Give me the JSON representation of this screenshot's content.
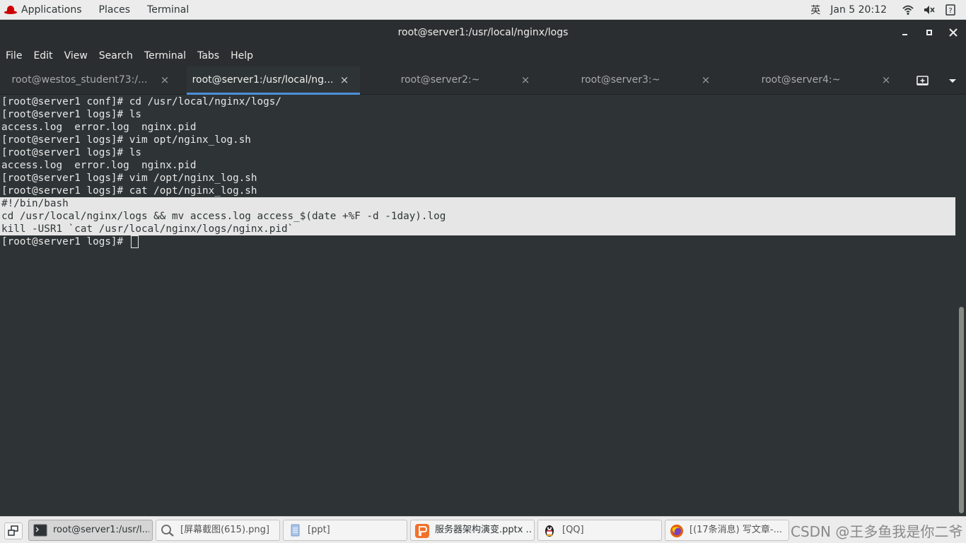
{
  "top_panel": {
    "menu": [
      "Applications",
      "Places",
      "Terminal"
    ],
    "input_method": "英",
    "clock": "Jan 5  20:12",
    "icons": [
      "wifi-icon",
      "volume-icon",
      "help-icon"
    ]
  },
  "window": {
    "title": "root@server1:/usr/local/nginx/logs",
    "controls": [
      "minimize-icon",
      "maximize-icon",
      "close-icon"
    ]
  },
  "menubar": [
    "File",
    "Edit",
    "View",
    "Search",
    "Terminal",
    "Tabs",
    "Help"
  ],
  "tabs": [
    {
      "label": "root@westos_student73:/...",
      "active": false
    },
    {
      "label": "root@server1:/usr/local/ng...",
      "active": true
    },
    {
      "label": "root@server2:~",
      "active": false
    },
    {
      "label": "root@server3:~",
      "active": false
    },
    {
      "label": "root@server4:~",
      "active": false
    }
  ],
  "tab_close": "×",
  "terminal": {
    "lines": [
      "[root@server1 conf]# cd /usr/local/nginx/logs/",
      "[root@server1 logs]# ls",
      "access.log  error.log  nginx.pid",
      "[root@server1 logs]# vim opt/nginx_log.sh",
      "[root@server1 logs]# ls",
      "access.log  error.log  nginx.pid",
      "[root@server1 logs]# vim /opt/nginx_log.sh",
      "[root@server1 logs]# cat /opt/nginx_log.sh"
    ],
    "selected_lines": [
      "#!/bin/bash",
      "cd /usr/local/nginx/logs && mv access.log access_$(date +%F -d -1day).log",
      "kill -USR1 `cat /usr/local/nginx/logs/nginx.pid`"
    ],
    "prompt": "[root@server1 logs]# "
  },
  "taskbar": {
    "tasks": [
      {
        "label": "root@server1:/usr/l...",
        "icon": "terminal-icon",
        "active": true
      },
      {
        "label": "[屏幕截图(615).png]",
        "icon": "image-viewer-icon",
        "active": false
      },
      {
        "label": "[ppt]",
        "icon": "document-icon",
        "active": false
      },
      {
        "label": "服务器架构演变.pptx ...",
        "icon": "presentation-icon",
        "active": false
      },
      {
        "label": "[QQ]",
        "icon": "qq-penguin-icon",
        "active": false
      },
      {
        "label": "[(17条消息) 写文章-...",
        "icon": "firefox-icon",
        "active": false
      }
    ],
    "watermark": "CSDN @王多鱼我是你二爷"
  },
  "colors": {
    "terminal_bg": "#2e3436",
    "terminal_fg": "#e8e8e7",
    "selection_bg": "#e6e6e6",
    "tab_accent": "#4a90d9",
    "panel_bg": "#ececec"
  }
}
